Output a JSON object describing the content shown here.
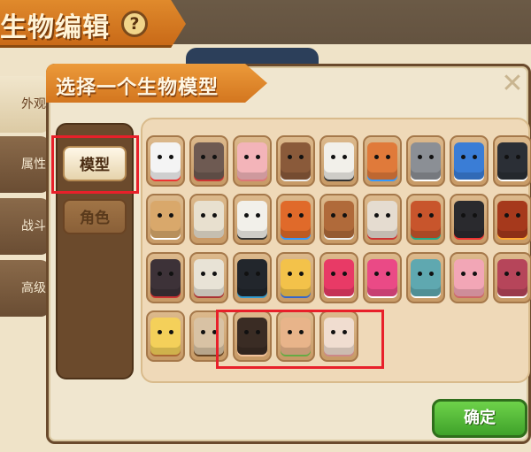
{
  "background": {
    "title": "生物编辑",
    "help_icon_glyph": "?",
    "tabs": [
      "外观",
      "属性",
      "战斗",
      "高级"
    ]
  },
  "dialog": {
    "title": "选择一个生物模型",
    "close_glyph": "✕",
    "categories": [
      {
        "label": "模型",
        "active": true
      },
      {
        "label": "角色",
        "active": false
      }
    ],
    "models": [
      {
        "name": "chicken",
        "color": "#f4f4f4",
        "accent": "#e33"
      },
      {
        "name": "wolf-red-eye",
        "color": "#6e5a52",
        "accent": "#c33"
      },
      {
        "name": "pig",
        "color": "#f3b4b9",
        "accent": "#d77"
      },
      {
        "name": "deer",
        "color": "#8a5a3a",
        "accent": "#eee"
      },
      {
        "name": "polar-bear",
        "color": "#f2f0ea",
        "accent": "#333"
      },
      {
        "name": "raptor",
        "color": "#e07a3a",
        "accent": "#39f"
      },
      {
        "name": "husky",
        "color": "#8b8f95",
        "accent": "#fff"
      },
      {
        "name": "blue-wolf",
        "color": "#3a7dd6",
        "accent": "#fff"
      },
      {
        "name": "penguin",
        "color": "#2b2f36",
        "accent": "#fff"
      },
      {
        "name": "ostrich",
        "color": "#d9a86b",
        "accent": "#fff"
      },
      {
        "name": "goose",
        "color": "#e8e0cf",
        "accent": "#c96"
      },
      {
        "name": "polar-bear-2",
        "color": "#f2f0ea",
        "accent": "#333"
      },
      {
        "name": "dragon-orange",
        "color": "#e06a2a",
        "accent": "#39f"
      },
      {
        "name": "mammoth",
        "color": "#b06a3a",
        "accent": "#eee"
      },
      {
        "name": "skull-mask",
        "color": "#e5dcd0",
        "accent": "#c33"
      },
      {
        "name": "tiki-mask",
        "color": "#c8552c",
        "accent": "#2a8"
      },
      {
        "name": "spider-eye",
        "color": "#2a2a2e",
        "accent": "#e33"
      },
      {
        "name": "lava-golem",
        "color": "#a6391c",
        "accent": "#fa3"
      },
      {
        "name": "dark-box",
        "color": "#3d3238",
        "accent": "#c33"
      },
      {
        "name": "skeleton",
        "color": "#e8e3d6",
        "accent": "#a33"
      },
      {
        "name": "hooded-ninja",
        "color": "#22262c",
        "accent": "#39c"
      },
      {
        "name": "straw-hat-boy",
        "color": "#f3c24a",
        "accent": "#36c"
      },
      {
        "name": "red-blob",
        "color": "#e83a66",
        "accent": "#fff"
      },
      {
        "name": "pink-blob",
        "color": "#ea4a86",
        "accent": "#fff"
      },
      {
        "name": "teal-wolf",
        "color": "#5fa8b0",
        "accent": "#fff"
      },
      {
        "name": "pink-pig-block",
        "color": "#f2a6b6",
        "accent": "#c66"
      },
      {
        "name": "boar-red",
        "color": "#b6455a",
        "accent": "#fff"
      },
      {
        "name": "yellow-chick",
        "color": "#f4d05a",
        "accent": "#a63"
      },
      {
        "name": "goat",
        "color": "#d8c2a4",
        "accent": "#642"
      },
      {
        "name": "hooded-girl",
        "color": "#3a2c24",
        "accent": "#f2c29a"
      },
      {
        "name": "bald-man",
        "color": "#e8b48a",
        "accent": "#6a4"
      },
      {
        "name": "helmet-girl",
        "color": "#f0ddd0",
        "accent": "#c88"
      }
    ]
  },
  "confirm_label": "确定"
}
